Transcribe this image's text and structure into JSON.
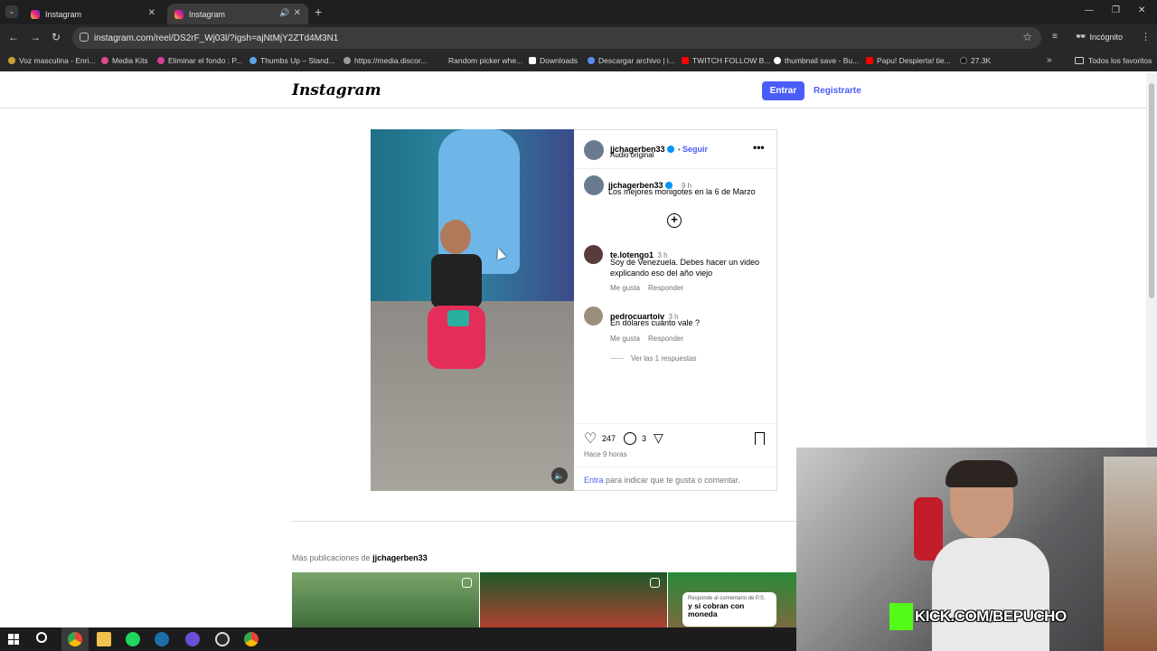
{
  "tabs": [
    {
      "label": "Instagram"
    },
    {
      "label": "Instagram"
    }
  ],
  "address": {
    "url": "instagram.com/reel/DS2rF_Wj03l/?igsh=ajNtMjY2ZTd4M3N1"
  },
  "incognito_label": "Incógnito",
  "bookmarks": [
    {
      "label": "Voz masculina - Enri..."
    },
    {
      "label": "Media Kits"
    },
    {
      "label": "Eliminar el fondo : P..."
    },
    {
      "label": "Thumbs Up – Stand..."
    },
    {
      "label": "https://media.discor..."
    },
    {
      "label": "Random picker whe..."
    },
    {
      "label": "Downloads"
    },
    {
      "label": "Descargar archivo | i..."
    },
    {
      "label": "TWITCH FOLLOW B..."
    },
    {
      "label": "thumbnail save - Bu..."
    },
    {
      "label": "Papu! Despierta! tie..."
    },
    {
      "label": "27.3K"
    }
  ],
  "all_bookmarks_label": "Todos los favoritos",
  "header": {
    "logo": "Instagram",
    "login": "Entrar",
    "signup": "Registrarte"
  },
  "post": {
    "author": "jjchagerben33",
    "follow": "Seguir",
    "audio": "Audio original",
    "caption_time": "9 h",
    "caption": "Los mejores monigotes en la 6 de Marzo",
    "comments": [
      {
        "user": "te.lotengo1",
        "time": "3 h",
        "text": "Soy de Venezuela. Debes hacer un video explicando eso del año viejo",
        "like": "Me gusta",
        "reply": "Responder"
      },
      {
        "user": "pedrocuartoiv",
        "time": "3 h",
        "text": "En dólares cuánto vale ?",
        "like": "Me gusta",
        "reply": "Responder"
      }
    ],
    "view_replies": "Ver las 1 respuestas",
    "likes": "247",
    "comment_count": "3",
    "posted": "Hace 9 horas",
    "login_prompt_link": "Entra",
    "login_prompt_rest": "para indicar que te gusta o comentar."
  },
  "more_posts": {
    "prefix": "Más publicaciones de",
    "user": "jjchagerben33"
  },
  "thumb_overlay": {
    "small": "Responde al comentario de P.S.",
    "big": "y si cobran con moneda"
  },
  "webcam_banner": "KICK.COM/BEPUCHO"
}
